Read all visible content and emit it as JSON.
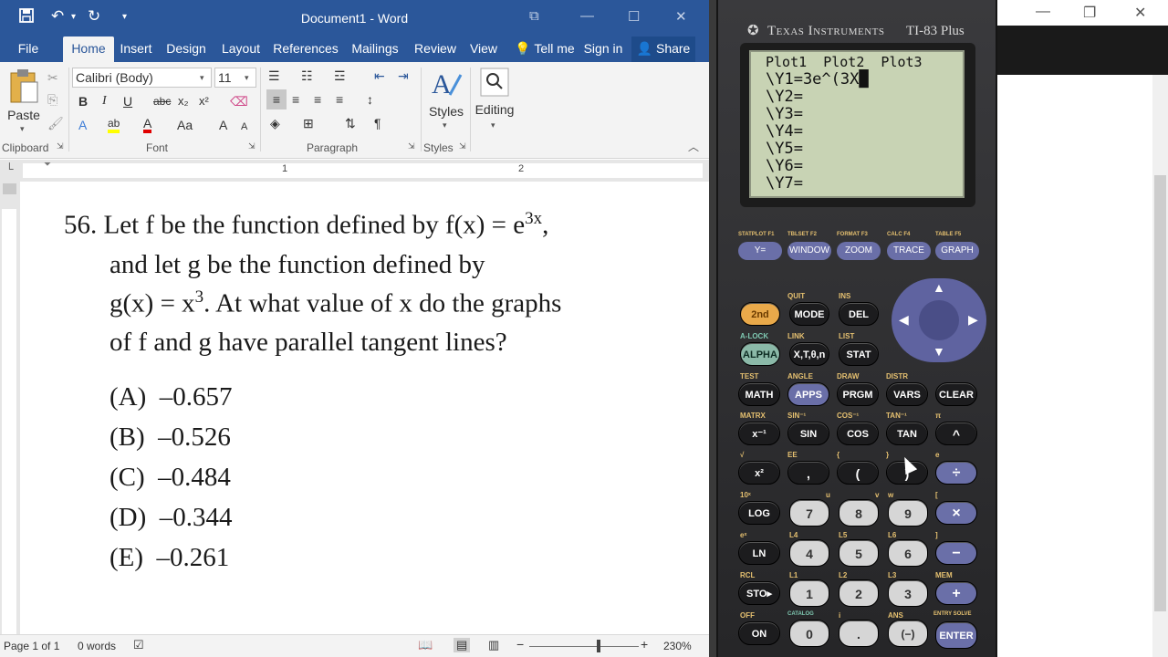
{
  "word": {
    "window_title": "Document1 - Word",
    "qa_icons": [
      "save-icon",
      "undo-icon",
      "redo-icon",
      "customize-icon"
    ],
    "tabs": [
      {
        "label": "File"
      },
      {
        "label": "Home"
      },
      {
        "label": "Insert"
      },
      {
        "label": "Design"
      },
      {
        "label": "Layout"
      },
      {
        "label": "References"
      },
      {
        "label": "Mailings"
      },
      {
        "label": "Review"
      },
      {
        "label": "View"
      },
      {
        "label": "Tell me"
      },
      {
        "label": "Sign in"
      }
    ],
    "active_tab": "Home",
    "share_label": "Share",
    "ribbon": {
      "paste_label": "Paste",
      "font_name": "Calibri (Body)",
      "font_size": "11",
      "styles_label": "Styles",
      "editing_label": "Editing",
      "groups": [
        "Clipboard",
        "Font",
        "Paragraph",
        "Styles"
      ],
      "font_buttons": [
        "B",
        "I",
        "U",
        "abc",
        "x₂",
        "x²"
      ],
      "font_row2": [
        "A",
        "A",
        "A",
        "Aa"
      ],
      "accent_colors": {
        "highlight": "#ffff00",
        "font_color": "#e00000"
      }
    },
    "ruler_numbers": [
      "1",
      "2"
    ],
    "document": {
      "problem_number": "56.",
      "lines": [
        "Let f be the function defined by f(x) = e",
        "and let g be the function defined by",
        "g(x) = x",
        "of f and g have parallel tangent lines?"
      ],
      "superscript_1": "3x",
      "line1_end": ",",
      "superscript_3": "3",
      "line3_rest": ". At what value of x do the graphs",
      "choices": [
        {
          "letter": "(A)",
          "value": "–0.657"
        },
        {
          "letter": "(B)",
          "value": "–0.526"
        },
        {
          "letter": "(C)",
          "value": "–0.484"
        },
        {
          "letter": "(D)",
          "value": "–0.344"
        },
        {
          "letter": "(E)",
          "value": "–0.261"
        }
      ]
    },
    "status": {
      "page": "Page 1 of 1",
      "words": "0 words",
      "zoom": "230%"
    }
  },
  "calculator": {
    "brand": "Texas Instruments",
    "model": "TI-83 Plus",
    "screen_lines": [
      "Plot1  Plot2  Plot3",
      "\\Y1=3e^(3X█",
      "\\Y2=",
      "\\Y3=",
      "\\Y4=",
      "\\Y5=",
      "\\Y6=",
      "\\Y7="
    ],
    "function_keys": [
      "Y=",
      "WINDOW",
      "ZOOM",
      "TRACE",
      "GRAPH"
    ],
    "function_labels": [
      "STATPLOT F1",
      "TBLSET F2",
      "FORMAT F3",
      "CALC F4",
      "TABLE F5"
    ],
    "rows": [
      [
        {
          "l": "2nd",
          "c": "yellow"
        },
        {
          "l": "MODE"
        },
        {
          "l": "DEL"
        }
      ],
      [
        {
          "l": "ALPHA",
          "c": "green"
        },
        {
          "l": "X,T,θ,n"
        },
        {
          "l": "STAT"
        }
      ],
      [
        {
          "l": "MATH"
        },
        {
          "l": "APPS",
          "c": "blue"
        },
        {
          "l": "PRGM"
        },
        {
          "l": "VARS"
        },
        {
          "l": "CLEAR"
        }
      ],
      [
        {
          "l": "x⁻¹"
        },
        {
          "l": "SIN"
        },
        {
          "l": "COS"
        },
        {
          "l": "TAN"
        },
        {
          "l": "^"
        }
      ],
      [
        {
          "l": "x²"
        },
        {
          "l": ","
        },
        {
          "l": "("
        },
        {
          "l": ")"
        },
        {
          "l": "÷",
          "c": "blue"
        }
      ],
      [
        {
          "l": "LOG"
        },
        {
          "l": "7",
          "c": "gray"
        },
        {
          "l": "8",
          "c": "gray"
        },
        {
          "l": "9",
          "c": "gray"
        },
        {
          "l": "×",
          "c": "blue"
        }
      ],
      [
        {
          "l": "LN"
        },
        {
          "l": "4",
          "c": "gray"
        },
        {
          "l": "5",
          "c": "gray"
        },
        {
          "l": "6",
          "c": "gray"
        },
        {
          "l": "−",
          "c": "blue"
        }
      ],
      [
        {
          "l": "STO▸"
        },
        {
          "l": "1",
          "c": "gray"
        },
        {
          "l": "2",
          "c": "gray"
        },
        {
          "l": "3",
          "c": "gray"
        },
        {
          "l": "+",
          "c": "blue"
        }
      ],
      [
        {
          "l": "ON"
        },
        {
          "l": "0",
          "c": "gray"
        },
        {
          "l": ".",
          "c": "gray"
        },
        {
          "l": "(−)",
          "c": "gray"
        },
        {
          "l": "ENTER",
          "c": "blue"
        }
      ]
    ],
    "second_labels": [
      "QUIT",
      "INS",
      "A-LOCK",
      "LINK",
      "LIST",
      "TEST",
      "ANGLE",
      "DRAW",
      "DISTR",
      "MATRX",
      "SIN⁻¹",
      "COS⁻¹",
      "TAN⁻¹",
      "π",
      "√",
      "EE",
      "{",
      "}",
      "e",
      "10ˣ",
      "u",
      "v",
      "w",
      "[",
      "eˣ",
      "L4",
      "L5",
      "L6",
      "]",
      "RCL",
      "L1",
      "L2",
      "L3",
      "MEM",
      "OFF",
      "CATALOG",
      "i",
      "ANS",
      "ENTRY SOLVE"
    ]
  }
}
